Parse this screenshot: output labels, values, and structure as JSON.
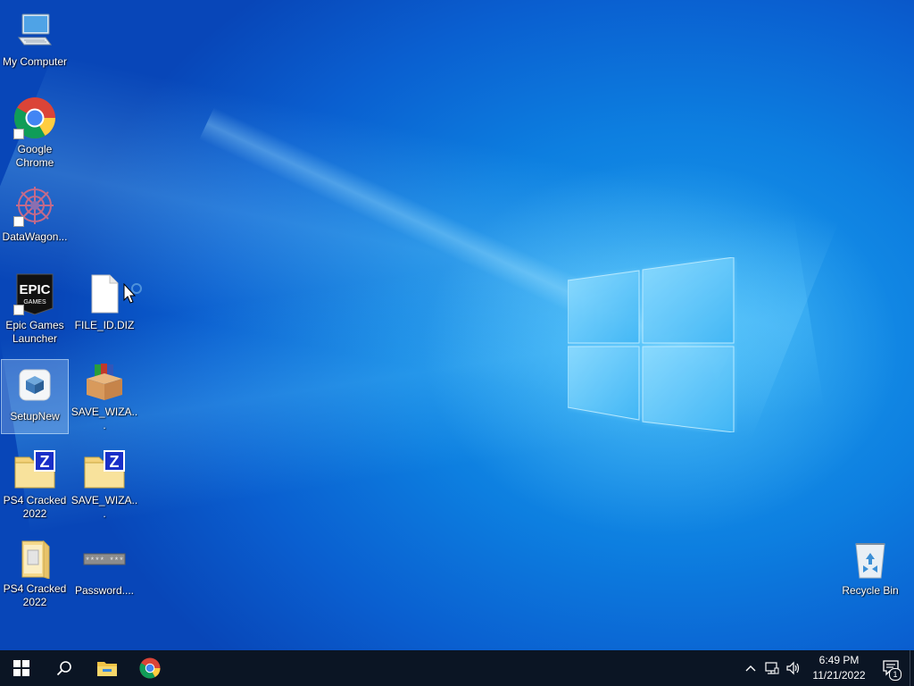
{
  "desktop": {
    "icons": [
      {
        "label": "My Computer",
        "icon": "computer-icon"
      },
      {
        "label": "Google Chrome",
        "icon": "chrome-icon",
        "shortcut": true
      },
      {
        "label": "DataWagon...",
        "icon": "datawagon-icon",
        "shortcut": true
      },
      {
        "label": "Epic Games Launcher",
        "icon": "epic-games-icon",
        "shortcut": true
      },
      {
        "label": "FILE_ID.DIZ",
        "icon": "blank-file-icon"
      },
      {
        "label": "SetupNew",
        "icon": "setup-icon",
        "selected": true
      },
      {
        "label": "SAVE_WIZA...",
        "icon": "winrar-icon"
      },
      {
        "label": "PS4 Cracked 2022",
        "icon": "zip-folder-icon"
      },
      {
        "label": "SAVE_WIZA...",
        "icon": "zip-folder-icon"
      },
      {
        "label": "PS4 Cracked 2022",
        "icon": "folder-icon"
      },
      {
        "label": "Password....",
        "icon": "password-file-icon"
      },
      {
        "label": "Recycle Bin",
        "icon": "recycle-bin-icon"
      }
    ]
  },
  "taskbar": {
    "start": "windows-start-icon",
    "search": "search-icon",
    "pinned": [
      "file-explorer-icon",
      "chrome-icon"
    ],
    "tray": {
      "icons": [
        "chevron-up-icon",
        "network-icon",
        "volume-icon"
      ],
      "time": "6:49 PM",
      "date": "11/21/2022",
      "notification_count": "1"
    }
  },
  "colors": {
    "taskbar": "#0b1524",
    "wallpaper_accent": "#0d7fe0"
  }
}
